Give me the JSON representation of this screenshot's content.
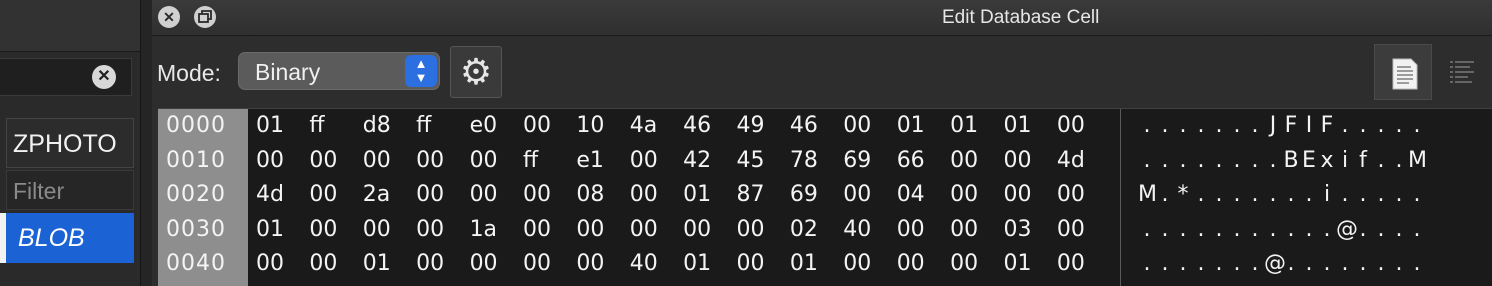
{
  "left_panel": {
    "column_header": "ZPHOTO",
    "filter_placeholder": "Filter",
    "cell_value": "BLOB"
  },
  "editor": {
    "title": "Edit Database Cell",
    "mode_label": "Mode:",
    "mode_value": "Binary",
    "mode_options": [
      "Binary"
    ],
    "accent_color": "#2c6fe0"
  },
  "hex_view": {
    "offsets": [
      "0000",
      "0010",
      "0020",
      "0030",
      "0040"
    ],
    "rows": [
      [
        "01",
        "ff",
        "d8",
        "ff",
        "e0",
        "00",
        "10",
        "4a",
        "46",
        "49",
        "46",
        "00",
        "01",
        "01",
        "01",
        "00"
      ],
      [
        "00",
        "00",
        "00",
        "00",
        "00",
        "ff",
        "e1",
        "00",
        "42",
        "45",
        "78",
        "69",
        "66",
        "00",
        "00",
        "4d"
      ],
      [
        "4d",
        "00",
        "2a",
        "00",
        "00",
        "00",
        "08",
        "00",
        "01",
        "87",
        "69",
        "00",
        "04",
        "00",
        "00",
        "00"
      ],
      [
        "01",
        "00",
        "00",
        "00",
        "1a",
        "00",
        "00",
        "00",
        "00",
        "00",
        "02",
        "40",
        "00",
        "00",
        "03",
        "00"
      ],
      [
        "00",
        "00",
        "01",
        "00",
        "00",
        "00",
        "00",
        "40",
        "01",
        "00",
        "01",
        "00",
        "00",
        "00",
        "01",
        "00"
      ]
    ],
    "ascii": [
      [
        ".",
        ".",
        ".",
        ".",
        ".",
        ".",
        ".",
        "J",
        "F",
        "I",
        "F",
        ".",
        ".",
        ".",
        ".",
        "."
      ],
      [
        ".",
        ".",
        ".",
        ".",
        ".",
        ".",
        ".",
        ".",
        "B",
        "E",
        "x",
        "i",
        "f",
        ".",
        ".",
        "M"
      ],
      [
        "M",
        ".",
        "*",
        ".",
        ".",
        ".",
        ".",
        ".",
        ".",
        ".",
        "i",
        ".",
        ".",
        ".",
        ".",
        "."
      ],
      [
        ".",
        ".",
        ".",
        ".",
        ".",
        ".",
        ".",
        ".",
        ".",
        ".",
        ".",
        "@",
        ".",
        ".",
        ".",
        "."
      ],
      [
        ".",
        ".",
        ".",
        ".",
        ".",
        ".",
        ".",
        "@",
        ".",
        ".",
        ".",
        ".",
        ".",
        ".",
        ".",
        "."
      ]
    ]
  },
  "icons": {
    "close": "close-icon",
    "float": "float-window-icon",
    "clear": "clear-search-icon",
    "settings": "gear-icon",
    "text_view": "text-document-icon",
    "hex_view": "hex-view-icon"
  }
}
